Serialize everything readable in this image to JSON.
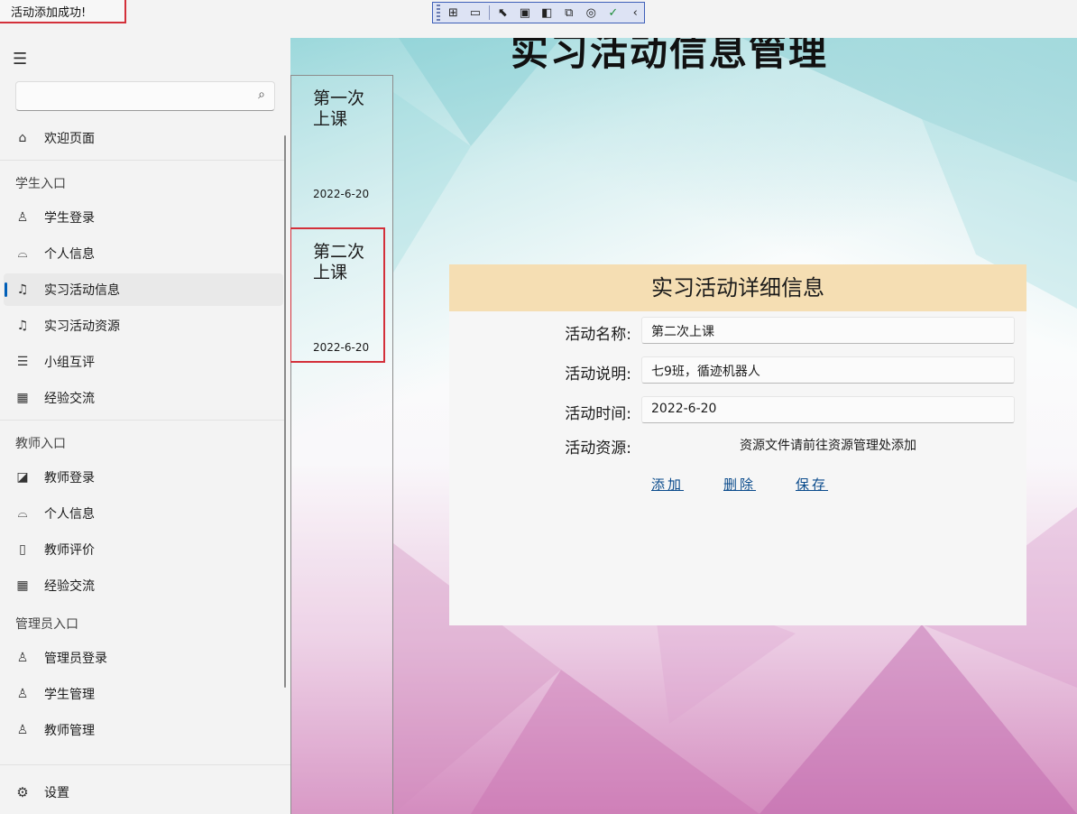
{
  "toast": "活动添加成功!",
  "devbar": {
    "tools": [
      "live-tree-icon",
      "camera-icon",
      "select-element-icon",
      "display-adorner-icon",
      "track-focus-icon",
      "layout-icon",
      "hot-reload-icon",
      "check-icon",
      "collapse-icon"
    ]
  },
  "sidebar": {
    "search_placeholder": "",
    "items": [
      {
        "label": "欢迎页面",
        "icon": "home-icon",
        "glyph": "⌂"
      },
      {
        "label": "学生入口",
        "header": true
      },
      {
        "label": "学生登录",
        "icon": "user-icon",
        "glyph": "♙"
      },
      {
        "label": "个人信息",
        "icon": "info-icon",
        "glyph": "⌓"
      },
      {
        "label": "实习活动信息",
        "icon": "music-icon",
        "glyph": "♫",
        "selected": true
      },
      {
        "label": "实习活动资源",
        "icon": "music-icon",
        "glyph": "♫"
      },
      {
        "label": "小组互评",
        "icon": "list-icon",
        "glyph": "☰"
      },
      {
        "label": "经验交流",
        "icon": "calendar-icon",
        "glyph": "▦"
      },
      {
        "label": "教师入口",
        "header": true
      },
      {
        "label": "教师登录",
        "icon": "chart-icon",
        "glyph": "◪"
      },
      {
        "label": "个人信息",
        "icon": "info-icon",
        "glyph": "⌓"
      },
      {
        "label": "教师评价",
        "icon": "phone-icon",
        "glyph": "▯"
      },
      {
        "label": "经验交流",
        "icon": "calendar-icon",
        "glyph": "▦"
      },
      {
        "label": "管理员入口",
        "header": true
      },
      {
        "label": "管理员登录",
        "icon": "admin-icon",
        "glyph": "♙"
      },
      {
        "label": "学生管理",
        "icon": "group-icon",
        "glyph": "♙"
      },
      {
        "label": "教师管理",
        "icon": "group-icon",
        "glyph": "♙"
      }
    ],
    "settings_label": "设置"
  },
  "main": {
    "title": "实习活动信息管理",
    "activities": [
      {
        "title": "第一次上课",
        "date": "2022-6-20"
      },
      {
        "title": "第二次上课",
        "date": "2022-6-20"
      }
    ],
    "detail": {
      "header": "实习活动详细信息",
      "name_label": "活动名称:",
      "name_value": "第二次上课",
      "desc_label": "活动说明:",
      "desc_value": "七9班，循迹机器人",
      "time_label": "活动时间:",
      "time_value": "2022-6-20",
      "resource_label": "活动资源:",
      "resource_note": "资源文件请前往资源管理处添加",
      "add_label": "添加",
      "delete_label": "删除",
      "save_label": "保存"
    }
  },
  "colors": {
    "accent": "#005fb8",
    "header_bg": "#f5deb3",
    "selection_border": "#d3303a",
    "link": "#0a4b8c"
  }
}
